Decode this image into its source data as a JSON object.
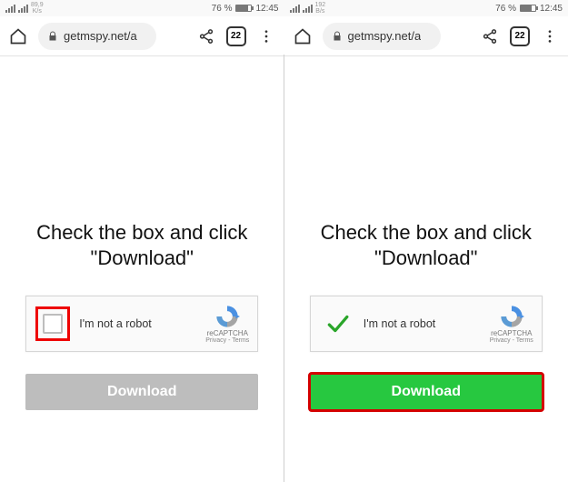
{
  "status": {
    "rate_up": "89,9",
    "rate_down": "K/s",
    "rate2_up": "192",
    "rate2_down": "B/s",
    "battery": "76 %",
    "time": "12:45"
  },
  "browser": {
    "url": "getmspy.net/a",
    "tab_count": "22"
  },
  "page": {
    "heading_l1": "Check the box and click",
    "heading_l2": "\"Download\"",
    "captcha_label": "I'm not a robot",
    "captcha_brand": "reCAPTCHA",
    "captcha_links": "Privacy - Terms",
    "download_label": "Download"
  }
}
